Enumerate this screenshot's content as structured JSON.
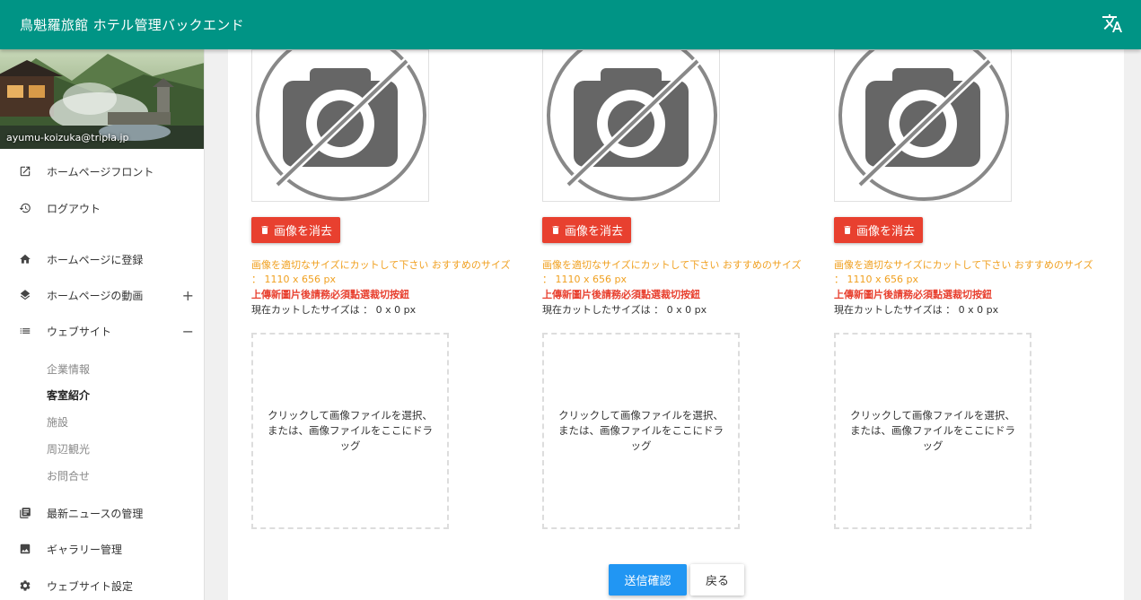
{
  "app": {
    "title": "鳥魁羅旅館 ホテル管理バックエンド"
  },
  "colors": {
    "header": "#009485",
    "danger": "#e8402f",
    "warning": "#f0a020",
    "primary": "#2196f3"
  },
  "sidebar": {
    "email": "ayumu-koizuka@tripla.jp",
    "items": [
      {
        "label": "ホームページフロント",
        "icon": "open-in-new-icon"
      },
      {
        "label": "ログアウト",
        "icon": "history-icon"
      },
      {
        "label": "ホームページに登録",
        "icon": "home-icon"
      },
      {
        "label": "ホームページの動画",
        "icon": "layers-icon",
        "toggle": "+"
      },
      {
        "label": "ウェブサイト",
        "icon": "list-icon",
        "toggle": "−"
      },
      {
        "label": "最新ニュースの管理",
        "icon": "library-books-icon"
      },
      {
        "label": "ギャラリー管理",
        "icon": "image-icon"
      },
      {
        "label": "ウェブサイト設定",
        "icon": "gear-icon"
      }
    ],
    "subitems": [
      {
        "label": "企業情報"
      },
      {
        "label": "客室紹介",
        "active": true
      },
      {
        "label": "施設"
      },
      {
        "label": "周辺観光"
      },
      {
        "label": "お問合せ"
      }
    ]
  },
  "uploads": [
    {
      "delete_label": "画像を消去",
      "hint": "画像を適切なサイズにカットして下さい おすすめのサイズ ： 1110 x 656 px",
      "warning": "上傳新圖片後請務必須點選裁切按鈕",
      "current_size": "現在カットしたサイズは ： 0 x 0 px",
      "drop_text": "クリックして画像ファイルを選択、または、画像ファイルをここにドラッグ"
    },
    {
      "delete_label": "画像を消去",
      "hint": "画像を適切なサイズにカットして下さい おすすめのサイズ ： 1110 x 656 px",
      "warning": "上傳新圖片後請務必須點選裁切按鈕",
      "current_size": "現在カットしたサイズは ： 0 x 0 px",
      "drop_text": "クリックして画像ファイルを選択、または、画像ファイルをここにドラッグ"
    },
    {
      "delete_label": "画像を消去",
      "hint": "画像を適切なサイズにカットして下さい おすすめのサイズ ： 1110 x 656 px",
      "warning": "上傳新圖片後請務必須點選裁切按鈕",
      "current_size": "現在カットしたサイズは ： 0 x 0 px",
      "drop_text": "クリックして画像ファイルを選択、または、画像ファイルをここにドラッグ"
    }
  ],
  "actions": {
    "submit_label": "送信確認",
    "back_label": "戻る"
  }
}
